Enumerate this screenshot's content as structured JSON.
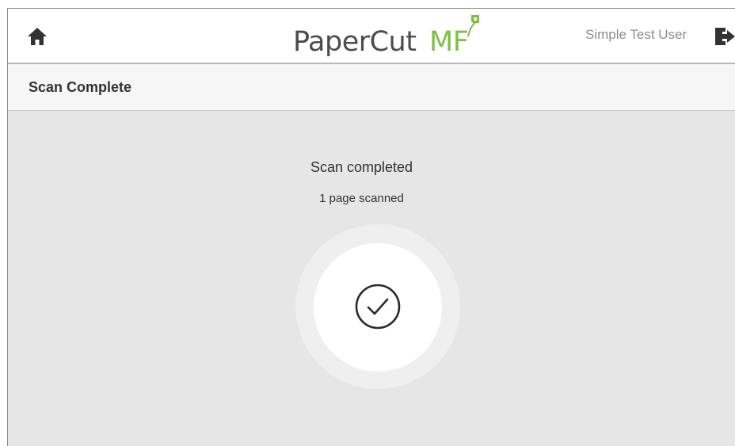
{
  "header": {
    "brand_primary": "PaperCut",
    "brand_secondary": "MF",
    "user_name": "Simple Test User",
    "home_icon": "home-icon",
    "logout_icon": "logout-icon"
  },
  "page": {
    "title": "Scan Complete"
  },
  "status": {
    "message": "Scan completed",
    "detail": "1 page scanned",
    "icon": "check-circle-icon"
  },
  "colors": {
    "brand_green": "#7dc142",
    "brand_gray": "#4c4c4c",
    "background": "#e6e6e6"
  }
}
